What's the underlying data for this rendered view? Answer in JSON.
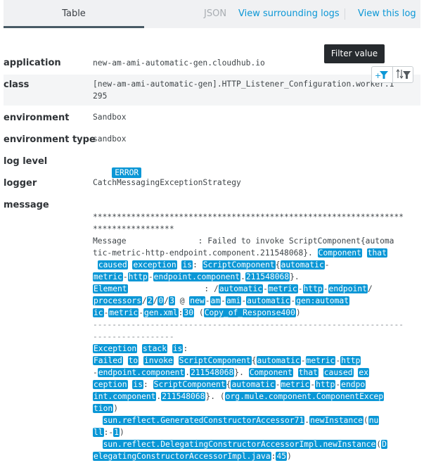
{
  "tabs": {
    "table_label": "Table",
    "json_label": "JSON",
    "view_surrounding_label": "View surrounding logs",
    "view_this_label": "View this log"
  },
  "tooltip": "Filter value",
  "colors": {
    "accent": "#0b97d6",
    "tab_underline": "#485a65",
    "tooltip_bg": "#262a2e"
  },
  "fields": [
    {
      "key": "application",
      "value": "new-am-ami-automatic-gen.cloudhub.io"
    },
    {
      "key": "class",
      "value": "[new-am-ami-automatic-gen].HTTP_Listener_Configuration.worker.1\n295"
    },
    {
      "key": "environment",
      "value": "Sandbox"
    },
    {
      "key": "environment type",
      "value": "sandbox"
    },
    {
      "key": "log level",
      "value": "ERROR"
    },
    {
      "key": "logger",
      "value": "CatchMessagingExceptionStrategy"
    },
    {
      "key": "message",
      "value": ""
    }
  ],
  "filter_buttons": [
    {
      "icon": "add-filter-icon",
      "label": "+"
    },
    {
      "icon": "sort-filter-icon",
      "label": "↑↓"
    }
  ],
  "message_lines": [
    [
      {
        "t": "*****************************************************************"
      }
    ],
    [
      {
        "t": "*****************"
      }
    ],
    [
      {
        "t": "Message               : Failed to invoke ScriptComponent{automa"
      }
    ],
    [
      {
        "t": "tic-metric-http-endpoint.component.211548068}. "
      },
      {
        "t": "Component",
        "h": 1
      },
      {
        "t": " "
      },
      {
        "t": "that",
        "h": 1
      }
    ],
    [
      {
        "t": " "
      },
      {
        "t": "caused",
        "h": 1
      },
      {
        "t": " "
      },
      {
        "t": "exception",
        "h": 1
      },
      {
        "t": " "
      },
      {
        "t": "is",
        "h": 1
      },
      {
        "t": ": "
      },
      {
        "t": "ScriptComponent",
        "h": 1
      },
      {
        "t": "{"
      },
      {
        "t": "automatic",
        "h": 1
      },
      {
        "t": "-"
      }
    ],
    [
      {
        "t": "metric",
        "h": 1
      },
      {
        "t": "-"
      },
      {
        "t": "http",
        "h": 1
      },
      {
        "t": "-"
      },
      {
        "t": "endpoint.component",
        "h": 1
      },
      {
        "t": "."
      },
      {
        "t": "211548068",
        "h": 1
      },
      {
        "t": "}."
      }
    ],
    [
      {
        "t": "Element",
        "h": 1
      },
      {
        "t": "                : /"
      },
      {
        "t": "automatic",
        "h": 1
      },
      {
        "t": "-"
      },
      {
        "t": "metric",
        "h": 1
      },
      {
        "t": "-"
      },
      {
        "t": "http",
        "h": 1
      },
      {
        "t": "-"
      },
      {
        "t": "endpoint",
        "h": 1
      },
      {
        "t": "/"
      }
    ],
    [
      {
        "t": "processors",
        "h": 1
      },
      {
        "t": "/"
      },
      {
        "t": "2",
        "h": 1
      },
      {
        "t": "/"
      },
      {
        "t": "0",
        "h": 1
      },
      {
        "t": "/"
      },
      {
        "t": "3",
        "h": 1
      },
      {
        "t": " @ "
      },
      {
        "t": "new",
        "h": 1
      },
      {
        "t": "-"
      },
      {
        "t": "am",
        "h": 1
      },
      {
        "t": "-"
      },
      {
        "t": "ami",
        "h": 1
      },
      {
        "t": "-"
      },
      {
        "t": "automatic",
        "h": 1
      },
      {
        "t": "-"
      },
      {
        "t": "gen:automat",
        "h": 1
      }
    ],
    [
      {
        "t": "ic",
        "h": 1
      },
      {
        "t": "-"
      },
      {
        "t": "metric",
        "h": 1
      },
      {
        "t": "-"
      },
      {
        "t": "gen.xml",
        "h": 1
      },
      {
        "t": ":"
      },
      {
        "t": "30",
        "h": 1
      },
      {
        "t": " ("
      },
      {
        "t": "Copy_of_Response400",
        "h": 1
      },
      {
        "t": ")"
      }
    ],
    [
      {
        "t": "-----------------------------------------------------------------",
        "d": 1
      }
    ],
    [
      {
        "t": "-----------------",
        "d": 1
      }
    ],
    [
      {
        "t": "Exception",
        "h": 1
      },
      {
        "t": " "
      },
      {
        "t": "stack",
        "h": 1
      },
      {
        "t": " "
      },
      {
        "t": "is",
        "h": 1
      },
      {
        "t": ":"
      }
    ],
    [
      {
        "t": "Failed",
        "h": 1
      },
      {
        "t": " "
      },
      {
        "t": "to",
        "h": 1
      },
      {
        "t": " "
      },
      {
        "t": "invoke",
        "h": 1
      },
      {
        "t": " "
      },
      {
        "t": "ScriptComponent",
        "h": 1
      },
      {
        "t": "{"
      },
      {
        "t": "automatic",
        "h": 1
      },
      {
        "t": "-"
      },
      {
        "t": "metric",
        "h": 1
      },
      {
        "t": "-"
      },
      {
        "t": "http",
        "h": 1
      }
    ],
    [
      {
        "t": "-"
      },
      {
        "t": "endpoint.component",
        "h": 1
      },
      {
        "t": "."
      },
      {
        "t": "211548068",
        "h": 1
      },
      {
        "t": "}. "
      },
      {
        "t": "Component",
        "h": 1
      },
      {
        "t": " "
      },
      {
        "t": "that",
        "h": 1
      },
      {
        "t": " "
      },
      {
        "t": "caused",
        "h": 1
      },
      {
        "t": " "
      },
      {
        "t": "ex",
        "h": 1
      }
    ],
    [
      {
        "t": "ception",
        "h": 1
      },
      {
        "t": " "
      },
      {
        "t": "is",
        "h": 1
      },
      {
        "t": ": "
      },
      {
        "t": "ScriptComponent",
        "h": 1
      },
      {
        "t": "{"
      },
      {
        "t": "automatic",
        "h": 1
      },
      {
        "t": "-"
      },
      {
        "t": "metric",
        "h": 1
      },
      {
        "t": "-"
      },
      {
        "t": "http",
        "h": 1
      },
      {
        "t": "-"
      },
      {
        "t": "endpo",
        "h": 1
      }
    ],
    [
      {
        "t": "int.component",
        "h": 1
      },
      {
        "t": "."
      },
      {
        "t": "211548068",
        "h": 1
      },
      {
        "t": "}. ("
      },
      {
        "t": "org.mule.component.ComponentExcep",
        "h": 1
      }
    ],
    [
      {
        "t": "tion",
        "h": 1
      },
      {
        "t": ")"
      }
    ],
    [
      {
        "t": "  "
      },
      {
        "t": "sun.reflect.GeneratedConstructorAccessor71",
        "h": 1
      },
      {
        "t": "."
      },
      {
        "t": "newInstance",
        "h": 1
      },
      {
        "t": "("
      },
      {
        "t": "nu",
        "h": 1
      }
    ],
    [
      {
        "t": "ll",
        "h": 1
      },
      {
        "t": ":-"
      },
      {
        "t": "1",
        "h": 1
      },
      {
        "t": ")"
      }
    ],
    [
      {
        "t": "  "
      },
      {
        "t": "sun.reflect.DelegatingConstructorAccessorImpl.newInstance",
        "h": 1
      },
      {
        "t": "("
      },
      {
        "t": "D",
        "h": 1
      }
    ],
    [
      {
        "t": "elegatingConstructorAccessorImpl.java",
        "h": 1
      },
      {
        "t": ":"
      },
      {
        "t": "45",
        "h": 1
      },
      {
        "t": ")"
      }
    ]
  ]
}
